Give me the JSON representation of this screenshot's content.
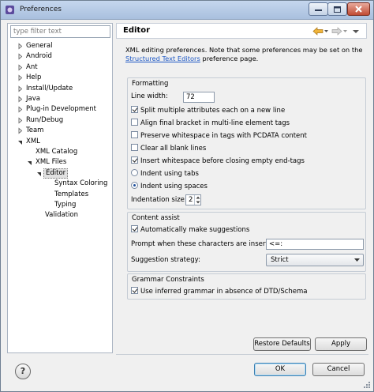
{
  "window": {
    "title": "Preferences"
  },
  "filter": {
    "placeholder": "type filter text"
  },
  "tree": [
    {
      "label": "General",
      "twisty": "collapsed"
    },
    {
      "label": "Android",
      "twisty": "collapsed"
    },
    {
      "label": "Ant",
      "twisty": "collapsed"
    },
    {
      "label": "Help",
      "twisty": "collapsed"
    },
    {
      "label": "Install/Update",
      "twisty": "collapsed"
    },
    {
      "label": "Java",
      "twisty": "collapsed"
    },
    {
      "label": "Plug-in Development",
      "twisty": "collapsed"
    },
    {
      "label": "Run/Debug",
      "twisty": "collapsed"
    },
    {
      "label": "Team",
      "twisty": "collapsed"
    },
    {
      "label": "XML",
      "twisty": "expanded"
    },
    {
      "label": "XML Catalog",
      "twisty": "none"
    },
    {
      "label": "XML Files",
      "twisty": "expanded"
    },
    {
      "label": "Editor",
      "twisty": "expanded",
      "selected": true
    },
    {
      "label": "Syntax Coloring",
      "twisty": "none"
    },
    {
      "label": "Templates",
      "twisty": "none"
    },
    {
      "label": "Typing",
      "twisty": "none"
    },
    {
      "label": "Validation",
      "twisty": "none"
    }
  ],
  "page": {
    "title": "Editor",
    "desc_line1": "XML editing preferences.  Note that some preferences may be set on the",
    "desc_link": "Structured Text Editors",
    "desc_after_link": " preference page."
  },
  "formatting": {
    "title": "Formatting",
    "line_width_label": "Line width:",
    "line_width_value": "72",
    "options": [
      {
        "label": "Split multiple attributes each on a new line",
        "checked": true
      },
      {
        "label": "Align final bracket in multi-line element tags",
        "checked": false
      },
      {
        "label": "Preserve whitespace in tags with PCDATA content",
        "checked": false
      },
      {
        "label": "Clear all blank lines",
        "checked": false
      },
      {
        "label": "Insert whitespace before closing empty end-tags",
        "checked": true
      }
    ],
    "indent_tabs_label": "Indent using tabs",
    "indent_spaces_label": "Indent using spaces",
    "indent_mode": "spaces",
    "indentation_size_label": "Indentation size:",
    "indentation_size_value": "2"
  },
  "content_assist": {
    "title": "Content assist",
    "auto_suggest_label": "Automatically make suggestions",
    "auto_suggest_checked": true,
    "prompt_label": "Prompt when these characters are inserted:",
    "prompt_value": "<=:",
    "strategy_label": "Suggestion strategy:",
    "strategy_value": "Strict"
  },
  "grammar": {
    "title": "Grammar Constraints",
    "inferred_label": "Use inferred grammar in absence of DTD/Schema",
    "inferred_checked": true
  },
  "buttons": {
    "restore_defaults": "Restore Defaults",
    "apply": "Apply",
    "ok": "OK",
    "cancel": "Cancel",
    "help": "?"
  },
  "colors": {
    "link": "#1e58c4",
    "titlebar": "#b9cde8",
    "close_button": "#c14b34"
  }
}
